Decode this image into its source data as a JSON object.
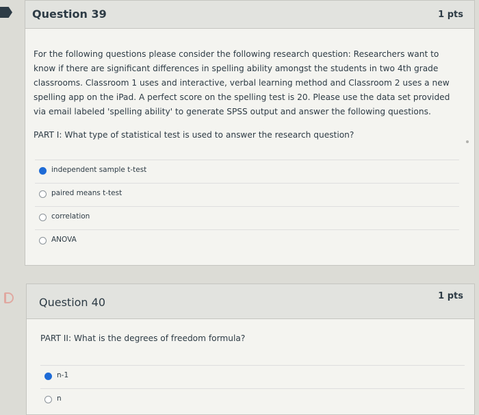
{
  "questions": [
    {
      "title": "Question 39",
      "points": "1 pts",
      "prompt_lines": [
        "For the following questions please consider the following research question: Researchers want to",
        "know if there are significant differences in spelling ability amongst the students in two 4th grade",
        "classrooms. Classroom 1 uses and interactive, verbal learning method and Classroom 2 uses a new",
        "spelling app on the iPad. A perfect score on the spelling test is 20. Please use the data set provided",
        "via email labeled 'spelling ability' to generate SPSS output and answer the following questions."
      ],
      "part": "PART I: What type of statistical test is used to answer the research question?",
      "answers": [
        {
          "label": "independent sample t-test",
          "selected": true
        },
        {
          "label": "paired means t-test",
          "selected": false
        },
        {
          "label": "correlation",
          "selected": false
        },
        {
          "label": "ANOVA",
          "selected": false
        }
      ]
    },
    {
      "title": "Question 40",
      "points": "1 pts",
      "part": "PART II: What is the degrees of freedom formula?",
      "answers": [
        {
          "label": "n-1",
          "selected": true
        },
        {
          "label": "n",
          "selected": false
        }
      ]
    }
  ],
  "colors": {
    "selected_radio": "#1e6bd6",
    "header_bg": "#e2e3df",
    "text": "#2d3b45"
  },
  "icons": {
    "flag": "flag-marker-icon",
    "bookmark": "bookmark-icon"
  }
}
